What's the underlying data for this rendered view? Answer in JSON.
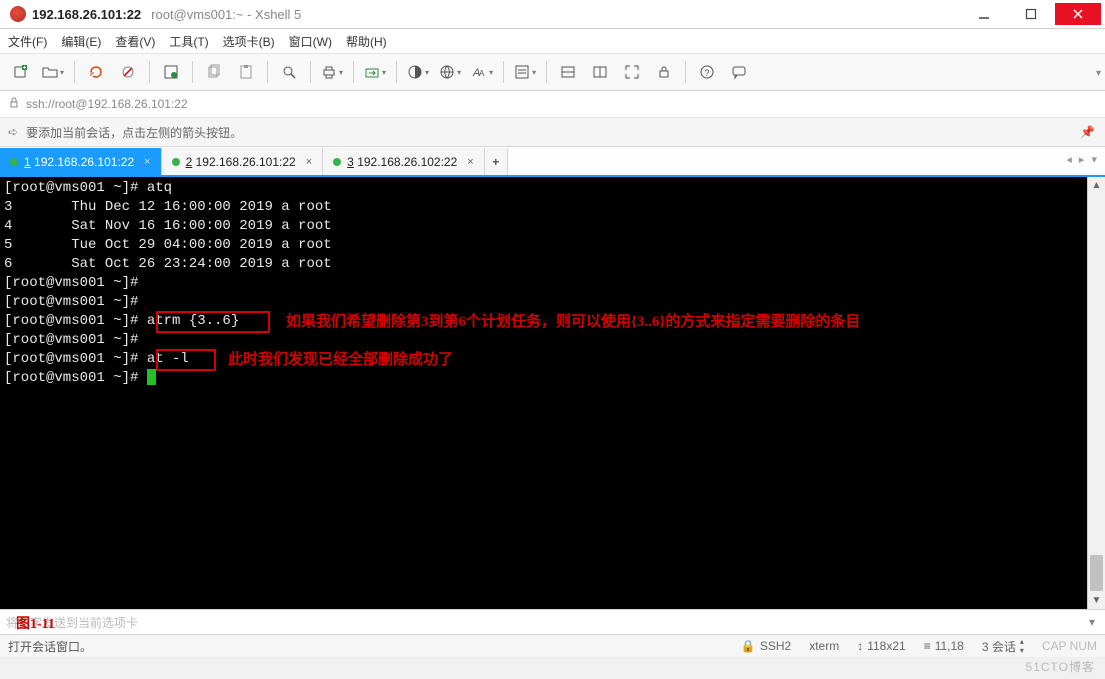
{
  "title": {
    "ip": "192.168.26.101:22",
    "sub": "root@vms001:~ - Xshell 5"
  },
  "menu": {
    "file": "文件(F)",
    "edit": "编辑(E)",
    "view": "查看(V)",
    "tools": "工具(T)",
    "tabs": "选项卡(B)",
    "window": "窗口(W)",
    "help": "帮助(H)"
  },
  "address": {
    "scheme_prefix": "ssh://",
    "url": "root@192.168.26.101:22"
  },
  "tip": {
    "text": "要添加当前会话，点击左侧的箭头按钮。"
  },
  "tabs": [
    {
      "idx": "1",
      "label": "192.168.26.101:22",
      "active": true
    },
    {
      "idx": "2",
      "label": "192.168.26.101:22",
      "active": false
    },
    {
      "idx": "3",
      "label": "192.168.26.102:22",
      "active": false
    }
  ],
  "terminal": {
    "lines": [
      "[root@vms001 ~]# atq",
      "3       Thu Dec 12 16:00:00 2019 a root",
      "4       Sat Nov 16 16:00:00 2019 a root",
      "5       Tue Oct 29 04:00:00 2019 a root",
      "6       Sat Oct 26 23:24:00 2019 a root",
      "[root@vms001 ~]#",
      "[root@vms001 ~]#",
      "[root@vms001 ~]# atrm {3..6}",
      "[root@vms001 ~]#",
      "[root@vms001 ~]# at -l",
      "[root@vms001 ~]# "
    ],
    "ann1": "如果我们希望删除第3到第6个计划任务，则可以使用{3..6}的方式来指定需要删除的条目",
    "ann2": "此时我们发现已经全部删除成功了"
  },
  "inputbar": {
    "placeholder": "将打字发送到当前选项卡",
    "fig": "图1-11"
  },
  "status": {
    "left": "打开会话窗口。",
    "proto": "SSH2",
    "term": "xterm",
    "size": "118x21",
    "pos": "11,18",
    "sess": "3 会话"
  },
  "watermark": "51CTO博客"
}
